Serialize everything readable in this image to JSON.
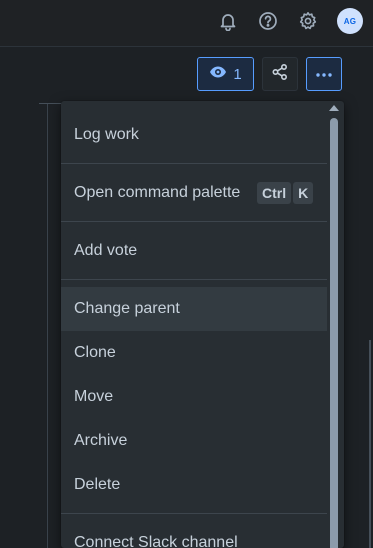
{
  "topbar": {
    "notifications_icon": "bell-icon",
    "help_icon": "question-circle-icon",
    "settings_icon": "gear-icon",
    "avatar_initials": "AG"
  },
  "actions": {
    "watch_count": "1",
    "watch_icon": "eye-icon",
    "share_icon": "share-icon",
    "more_icon": "more-horizontal-icon"
  },
  "menu": {
    "log_work": "Log work",
    "open_command_palette": "Open command palette",
    "shortcut_keys": [
      "Ctrl",
      "K"
    ],
    "add_vote": "Add vote",
    "change_parent": "Change parent",
    "clone": "Clone",
    "move": "Move",
    "archive": "Archive",
    "delete": "Delete",
    "connect_slack": "Connect Slack channel"
  },
  "colors": {
    "background": "#1d2125",
    "menu_background": "#282e33",
    "accent_blue": "#579dff",
    "text": "#c7d1db"
  }
}
